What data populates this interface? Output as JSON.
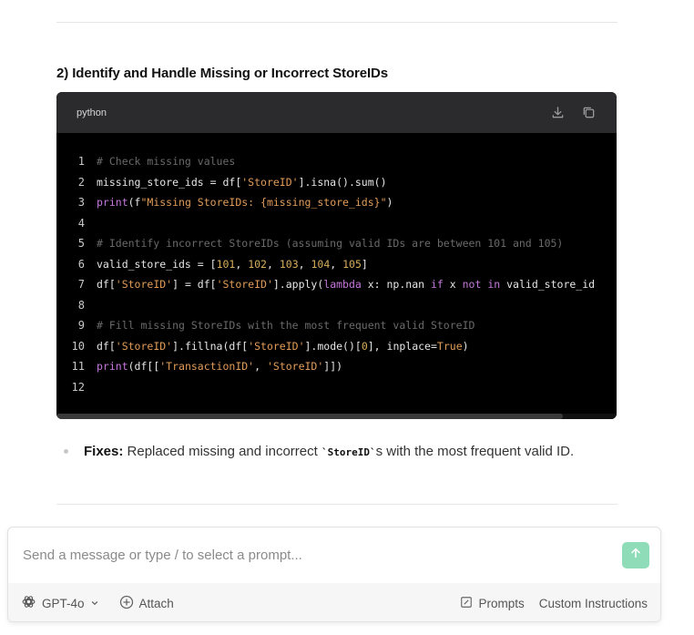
{
  "section": {
    "heading": "2) Identify and Handle Missing or Incorrect StoreIDs"
  },
  "code_block": {
    "language": "python",
    "icons": {
      "download": "download-icon",
      "copy": "copy-icon"
    },
    "lines": [
      {
        "n": "1",
        "tokens": [
          {
            "t": "# Check missing values",
            "c": "comment"
          }
        ]
      },
      {
        "n": "2",
        "tokens": [
          {
            "t": "missing_store_ids = df[",
            "c": "plain"
          },
          {
            "t": "'StoreID'",
            "c": "str"
          },
          {
            "t": "].isna().sum()",
            "c": "plain"
          }
        ]
      },
      {
        "n": "3",
        "tokens": [
          {
            "t": "print",
            "c": "kw"
          },
          {
            "t": "(f",
            "c": "plain"
          },
          {
            "t": "\"Missing StoreIDs: {missing_store_ids}\"",
            "c": "str"
          },
          {
            "t": ")",
            "c": "plain"
          }
        ]
      },
      {
        "n": "4",
        "tokens": []
      },
      {
        "n": "5",
        "tokens": [
          {
            "t": "# Identify incorrect StoreIDs (assuming valid IDs are between 101 and 105)",
            "c": "comment"
          }
        ]
      },
      {
        "n": "6",
        "tokens": [
          {
            "t": "valid_store_ids = [",
            "c": "plain"
          },
          {
            "t": "101",
            "c": "num"
          },
          {
            "t": ", ",
            "c": "plain"
          },
          {
            "t": "102",
            "c": "num"
          },
          {
            "t": ", ",
            "c": "plain"
          },
          {
            "t": "103",
            "c": "num"
          },
          {
            "t": ", ",
            "c": "plain"
          },
          {
            "t": "104",
            "c": "num"
          },
          {
            "t": ", ",
            "c": "plain"
          },
          {
            "t": "105",
            "c": "num"
          },
          {
            "t": "]",
            "c": "plain"
          }
        ]
      },
      {
        "n": "7",
        "tokens": [
          {
            "t": "df[",
            "c": "plain"
          },
          {
            "t": "'StoreID'",
            "c": "str"
          },
          {
            "t": "] = df[",
            "c": "plain"
          },
          {
            "t": "'StoreID'",
            "c": "str"
          },
          {
            "t": "].apply(",
            "c": "plain"
          },
          {
            "t": "lambda",
            "c": "kw"
          },
          {
            "t": " x: np.nan ",
            "c": "plain"
          },
          {
            "t": "if",
            "c": "kw"
          },
          {
            "t": " x ",
            "c": "plain"
          },
          {
            "t": "not",
            "c": "kw"
          },
          {
            "t": " ",
            "c": "plain"
          },
          {
            "t": "in",
            "c": "kw"
          },
          {
            "t": " valid_store_id",
            "c": "plain"
          }
        ]
      },
      {
        "n": "8",
        "tokens": []
      },
      {
        "n": "9",
        "tokens": [
          {
            "t": "# Fill missing StoreIDs with the most frequent valid StoreID",
            "c": "comment"
          }
        ]
      },
      {
        "n": "10",
        "tokens": [
          {
            "t": "df[",
            "c": "plain"
          },
          {
            "t": "'StoreID'",
            "c": "str"
          },
          {
            "t": "].fillna(df[",
            "c": "plain"
          },
          {
            "t": "'StoreID'",
            "c": "str"
          },
          {
            "t": "].mode()[",
            "c": "plain"
          },
          {
            "t": "0",
            "c": "num"
          },
          {
            "t": "], inplace=",
            "c": "plain"
          },
          {
            "t": "True",
            "c": "str"
          },
          {
            "t": ")",
            "c": "plain"
          }
        ]
      },
      {
        "n": "11",
        "tokens": [
          {
            "t": "print",
            "c": "kw"
          },
          {
            "t": "(df[[",
            "c": "plain"
          },
          {
            "t": "'TransactionID'",
            "c": "str"
          },
          {
            "t": ", ",
            "c": "plain"
          },
          {
            "t": "'StoreID'",
            "c": "str"
          },
          {
            "t": "]])",
            "c": "plain"
          }
        ]
      },
      {
        "n": "12",
        "tokens": []
      }
    ]
  },
  "fixes": {
    "label": "Fixes:",
    "text_before": " Replaced missing and incorrect ",
    "code": "`StoreID`",
    "text_after": "s with the most frequent valid ID."
  },
  "composer": {
    "placeholder": "Send a message or type / to select a prompt...",
    "send_icon": "arrow-up-icon",
    "model_label": "GPT-4o",
    "attach_label": "Attach",
    "prompts_label": "Prompts",
    "custom_instructions_label": "Custom Instructions",
    "colors": {
      "send_button": "#8fdcb8"
    }
  }
}
